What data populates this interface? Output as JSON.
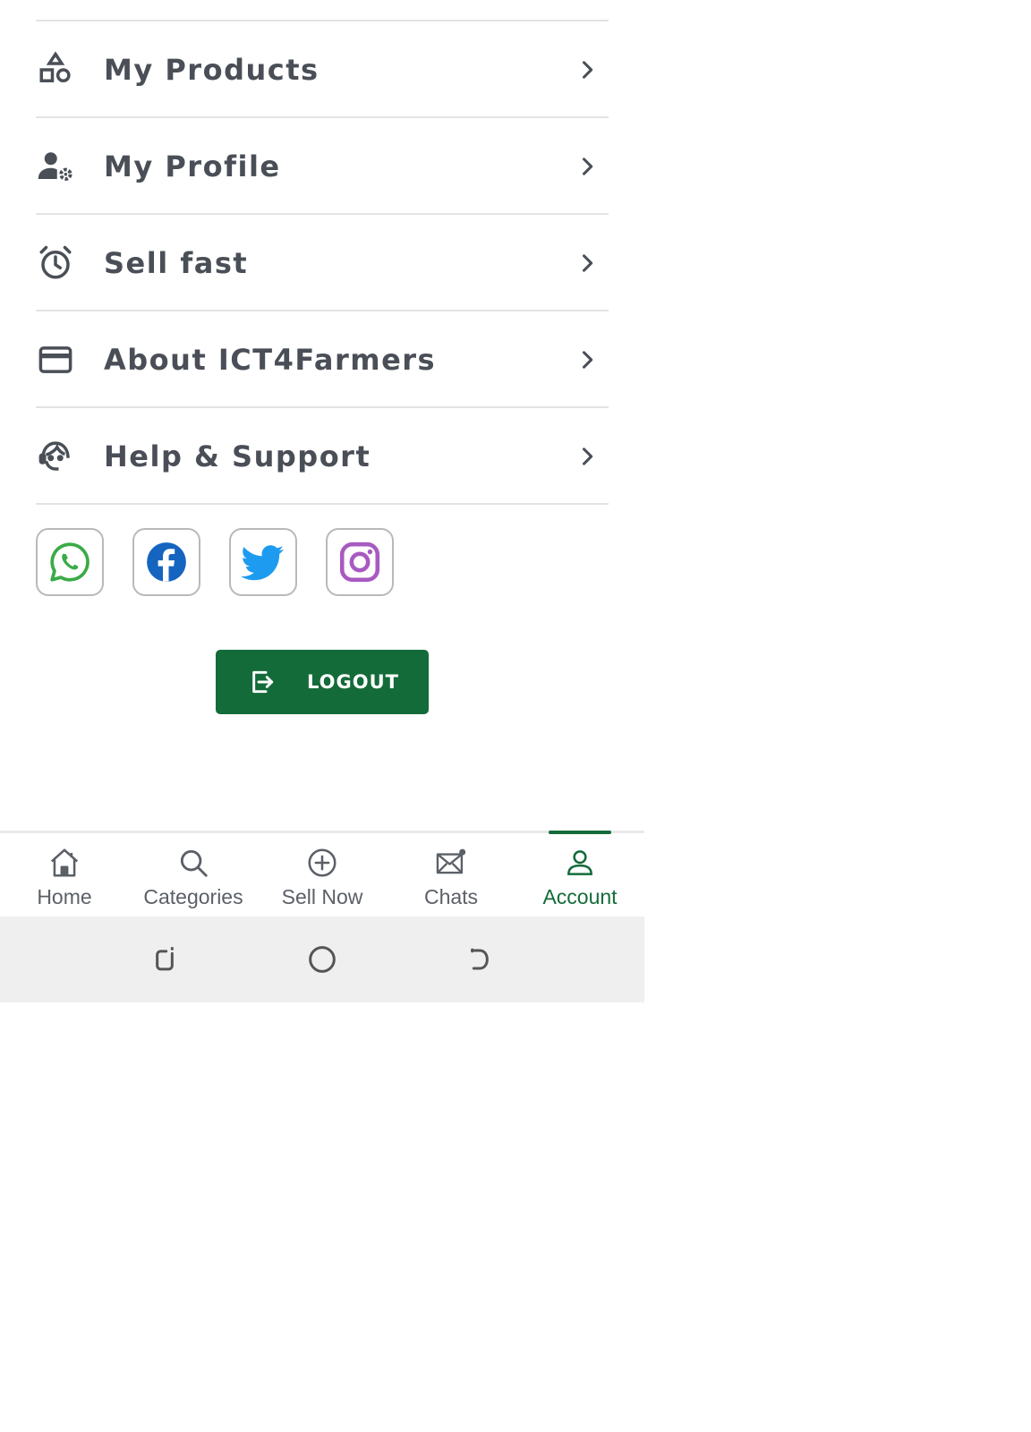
{
  "menu": {
    "items": [
      {
        "label": "My Products",
        "icon": "shapes-icon"
      },
      {
        "label": "My Profile",
        "icon": "user-settings-icon"
      },
      {
        "label": "Sell fast",
        "icon": "alarm-clock-icon"
      },
      {
        "label": "About ICT4Farmers",
        "icon": "card-icon"
      },
      {
        "label": "Help & Support",
        "icon": "support-agent-icon"
      }
    ]
  },
  "socials": [
    {
      "name": "whatsapp-icon",
      "color": "#3bab47"
    },
    {
      "name": "facebook-icon",
      "color": "#1565c0"
    },
    {
      "name": "twitter-icon",
      "color": "#1d9bf0"
    },
    {
      "name": "instagram-icon",
      "color": "#a85ac0"
    }
  ],
  "logout": {
    "label": "LOGOUT",
    "bg_color": "#146b3a"
  },
  "bottom_nav": {
    "items": [
      {
        "label": "Home",
        "icon": "home-icon"
      },
      {
        "label": "Categories",
        "icon": "search-icon"
      },
      {
        "label": "Sell Now",
        "icon": "plus-circle-icon"
      },
      {
        "label": "Chats",
        "icon": "mail-icon"
      },
      {
        "label": "Account",
        "icon": "user-icon",
        "active": true
      }
    ],
    "active_color": "#146b3a"
  },
  "system_nav": [
    "recent-apps-icon",
    "home-circle-icon",
    "back-icon"
  ]
}
